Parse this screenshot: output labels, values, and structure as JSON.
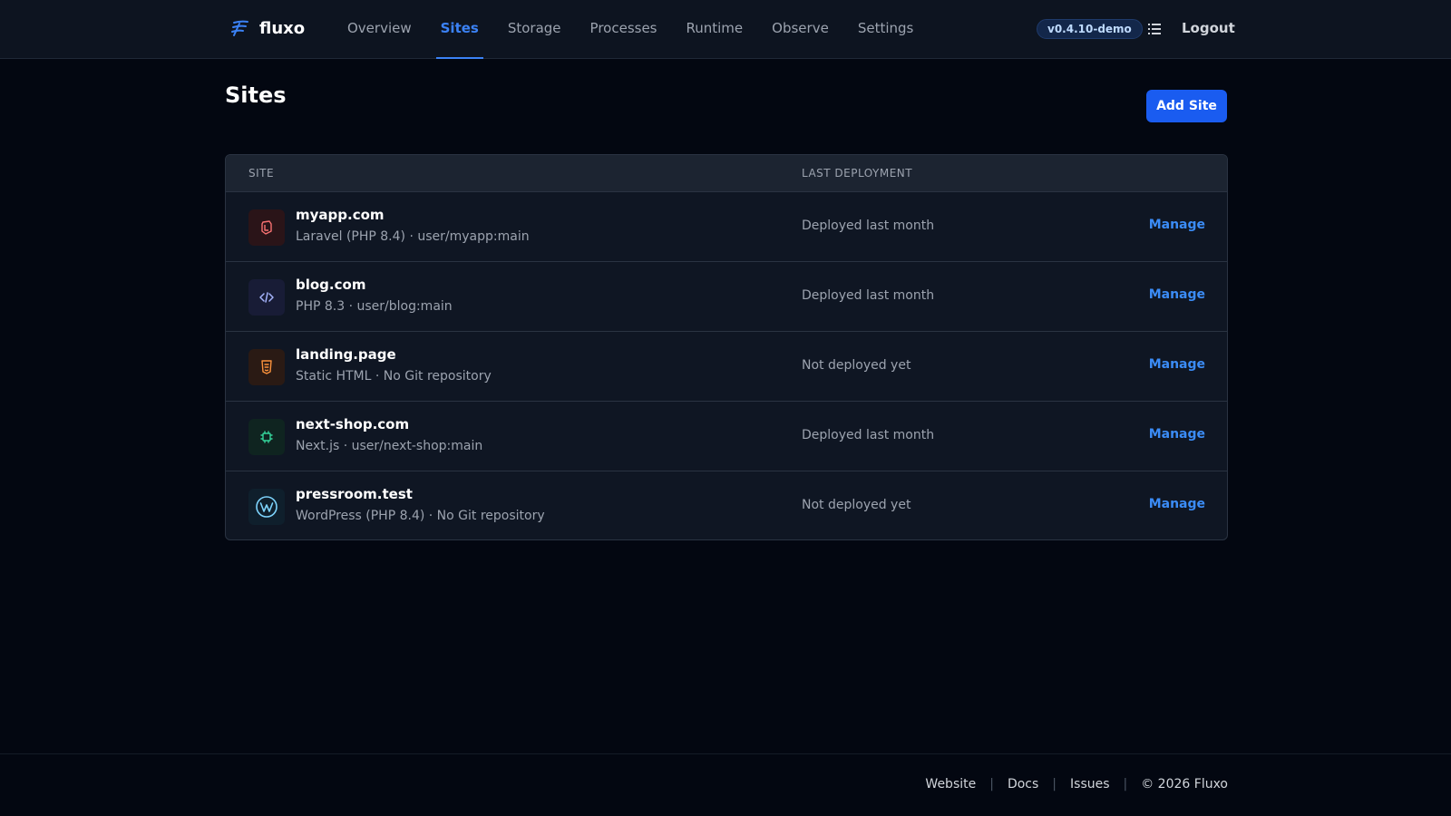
{
  "header": {
    "brand": "fluxo",
    "nav": [
      {
        "label": "Overview"
      },
      {
        "label": "Sites"
      },
      {
        "label": "Storage"
      },
      {
        "label": "Processes"
      },
      {
        "label": "Runtime"
      },
      {
        "label": "Observe"
      },
      {
        "label": "Settings"
      }
    ],
    "active_nav": "Sites",
    "version": "v0.4.10-demo",
    "menu_icon": "grid-menu-icon",
    "logout": "Logout"
  },
  "page": {
    "title": "Sites",
    "add_button": "Add Site"
  },
  "table": {
    "columns": {
      "site": "SITE",
      "last_deployment": "LAST DEPLOYMENT"
    },
    "rows": [
      {
        "name": "myapp.com",
        "meta": "Laravel (PHP 8.4) · user/myapp:main",
        "deployment": "Deployed last month",
        "action": "Manage",
        "icon": "laravel-icon",
        "icon_color": "#f87171",
        "icon_bg": "#2a1418"
      },
      {
        "name": "blog.com",
        "meta": "PHP 8.3 · user/blog:main",
        "deployment": "Deployed last month",
        "action": "Manage",
        "icon": "php-icon",
        "icon_color": "#a5b4fc",
        "icon_bg": "#181c36"
      },
      {
        "name": "landing.page",
        "meta": "Static HTML · No Git repository",
        "deployment": "Not deployed yet",
        "action": "Manage",
        "icon": "html-icon",
        "icon_color": "#fb923c",
        "icon_bg": "#2a1a14"
      },
      {
        "name": "next-shop.com",
        "meta": "Next.js · user/next-shop:main",
        "deployment": "Deployed last month",
        "action": "Manage",
        "icon": "nextjs-icon",
        "icon_color": "#34d399",
        "icon_bg": "#0f2420"
      },
      {
        "name": "pressroom.test",
        "meta": "WordPress (PHP 8.4) · No Git repository",
        "deployment": "Not deployed yet",
        "action": "Manage",
        "icon": "wordpress-icon",
        "icon_color": "#7dd3fc",
        "icon_bg": "#0f1f2c"
      }
    ]
  },
  "footer": {
    "links": [
      "Website",
      "Docs",
      "Issues"
    ],
    "copyright": "© 2026 Fluxo"
  },
  "colors": {
    "accent": "#3b82f6",
    "primary_button": "#1a5cf0",
    "background": "#030711",
    "topbar": "#0d1420",
    "table_header": "#1c2431"
  }
}
